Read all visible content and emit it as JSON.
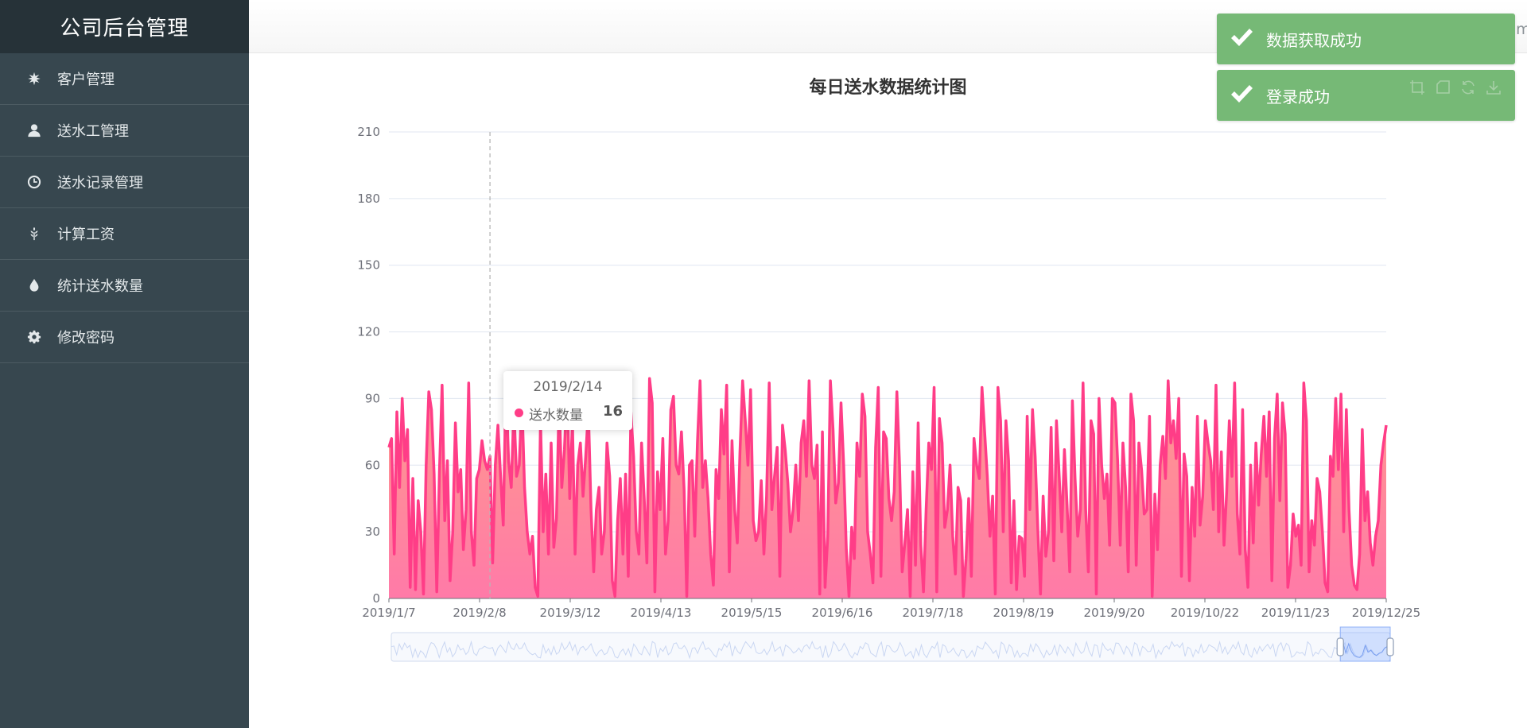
{
  "app": {
    "title": "公司后台管理"
  },
  "sidebar": {
    "items": [
      {
        "label": "客户管理",
        "icon": "snowflake-icon"
      },
      {
        "label": "送水工管理",
        "icon": "user-icon"
      },
      {
        "label": "送水记录管理",
        "icon": "clock-icon"
      },
      {
        "label": "计算工资",
        "icon": "wheat-icon"
      },
      {
        "label": "统计送水数量",
        "icon": "drop-icon"
      },
      {
        "label": "修改密码",
        "icon": "gear-icon"
      }
    ]
  },
  "header": {
    "user_label": "用户:adm"
  },
  "toasts": [
    {
      "text": "数据获取成功"
    },
    {
      "text": "登录成功"
    }
  ],
  "colors": {
    "sidebar": "#37474f",
    "brand_bar": "#263238",
    "toast": "#76b976",
    "series_line": "#ff3d87",
    "area_top": "#ff9a8c",
    "area_bottom": "#ff7aa8"
  },
  "tooltip": {
    "date": "2019/2/14",
    "series": "送水数量",
    "value": "16"
  },
  "chart_data": {
    "type": "area",
    "title": "每日送水数据统计图",
    "series_name": "送水数量",
    "ylim": [
      0,
      210
    ],
    "y_ticks": [
      "0",
      "30",
      "60",
      "90",
      "120",
      "150",
      "180",
      "210"
    ],
    "x_ticks": [
      "2019/1/7",
      "2019/2/8",
      "2019/3/12",
      "2019/4/13",
      "2019/5/15",
      "2019/6/16",
      "2019/7/18",
      "2019/8/19",
      "2019/9/20",
      "2019/10/22",
      "2019/11/23",
      "2019/12/25"
    ],
    "x_start": "2019/1/7",
    "x_end": "2019/12/25",
    "values": [
      68,
      72,
      20,
      84,
      50,
      90,
      62,
      76,
      5,
      54,
      4,
      44,
      30,
      2,
      60,
      93,
      85,
      56,
      3,
      57,
      96,
      35,
      62,
      8,
      30,
      79,
      48,
      58,
      22,
      40,
      97,
      30,
      15,
      54,
      58,
      71,
      62,
      58,
      64,
      16,
      60,
      78,
      55,
      33,
      98,
      62,
      50,
      86,
      55,
      60,
      90,
      50,
      30,
      20,
      28,
      5,
      1,
      80,
      30,
      56,
      20,
      70,
      23,
      36,
      90,
      50,
      67,
      97,
      45,
      80,
      20,
      60,
      70,
      46,
      64,
      85,
      40,
      12,
      40,
      50,
      20,
      30,
      70,
      55,
      8,
      1,
      35,
      54,
      20,
      56,
      10,
      84,
      64,
      30,
      20,
      70,
      45,
      16,
      99,
      88,
      3,
      57,
      40,
      72,
      20,
      35,
      85,
      91,
      60,
      56,
      75,
      49,
      1,
      60,
      62,
      28,
      70,
      98,
      50,
      62,
      45,
      20,
      6,
      58,
      45,
      85,
      65,
      96,
      12,
      71,
      40,
      25,
      66,
      98,
      80,
      60,
      94,
      35,
      26,
      30,
      53,
      20,
      46,
      97,
      40,
      55,
      68,
      10,
      78,
      67,
      52,
      30,
      40,
      60,
      35,
      70,
      80,
      55,
      98,
      60,
      54,
      69,
      2,
      75,
      5,
      28,
      98,
      76,
      43,
      52,
      88,
      60,
      22,
      1,
      32,
      18,
      70,
      55,
      92,
      82,
      30,
      20,
      7,
      68,
      95,
      10,
      75,
      72,
      45,
      35,
      48,
      93,
      60,
      12,
      25,
      40,
      1,
      57,
      15,
      79,
      24,
      3,
      40,
      70,
      58,
      95,
      3,
      81,
      70,
      32,
      40,
      60,
      28,
      11,
      50,
      44,
      1,
      18,
      45,
      10,
      72,
      60,
      54,
      95,
      75,
      55,
      28,
      46,
      2,
      95,
      80,
      30,
      80,
      62,
      7,
      44,
      4,
      28,
      27,
      10,
      82,
      40,
      85,
      64,
      31,
      2,
      46,
      19,
      30,
      77,
      17,
      80,
      56,
      30,
      67,
      42,
      12,
      89,
      54,
      28,
      40,
      97,
      40,
      12,
      80,
      74,
      2,
      90,
      60,
      45,
      56,
      24,
      90,
      88,
      62,
      24,
      70,
      50,
      12,
      92,
      80,
      15,
      70,
      58,
      38,
      40,
      82,
      1,
      47,
      22,
      60,
      73,
      54,
      98,
      70,
      80,
      63,
      90,
      10,
      65,
      55,
      8,
      50,
      28,
      82,
      33,
      46,
      80,
      70,
      62,
      40,
      96,
      30,
      66,
      24,
      48,
      80,
      55,
      97,
      38,
      20,
      85,
      22,
      5,
      60,
      25,
      70,
      42,
      65,
      82,
      55,
      84,
      8,
      72,
      92,
      44,
      88,
      74,
      5,
      15,
      38,
      28,
      33,
      15,
      97,
      80,
      12,
      35,
      24,
      54,
      48,
      30,
      7,
      3,
      64,
      55,
      90,
      58,
      92,
      30,
      85,
      40,
      15,
      6,
      4,
      20,
      76,
      35,
      48,
      25,
      15,
      28,
      35,
      60,
      70,
      78
    ],
    "grid": true,
    "dataZoom": {
      "start_percent": 95,
      "end_percent": 100
    }
  }
}
